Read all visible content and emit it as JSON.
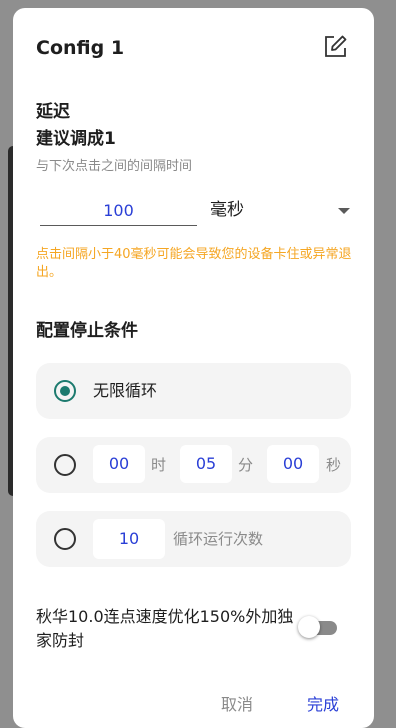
{
  "dialog": {
    "title": "Config 1",
    "edit_icon": "edit-square-icon"
  },
  "delay": {
    "heading": "延迟",
    "suggestion": "建议调成1",
    "hint": "与下次点击之间的间隔时间",
    "value": "100",
    "unit_selected": "毫秒",
    "warning": "点击间隔小于40毫秒可能会导致您的设备卡住或异常退出。"
  },
  "stop_condition": {
    "heading": "配置停止条件",
    "option_infinite": {
      "label": "无限循环",
      "selected": true
    },
    "option_time": {
      "selected": false,
      "hours": "00",
      "hours_unit": "时",
      "minutes": "05",
      "minutes_unit": "分",
      "seconds": "00",
      "seconds_unit": "秒"
    },
    "option_count": {
      "selected": false,
      "value": "10",
      "label": "循环运行次数"
    }
  },
  "boost_switch": {
    "label": "秋华10.0连点速度优化150%外加独家防封",
    "on": false
  },
  "footer": {
    "cancel": "取消",
    "confirm": "完成"
  },
  "colors": {
    "accent_blue": "#2a3fd6",
    "radio_teal": "#1c7a6e",
    "warning_orange": "#f5a623"
  }
}
